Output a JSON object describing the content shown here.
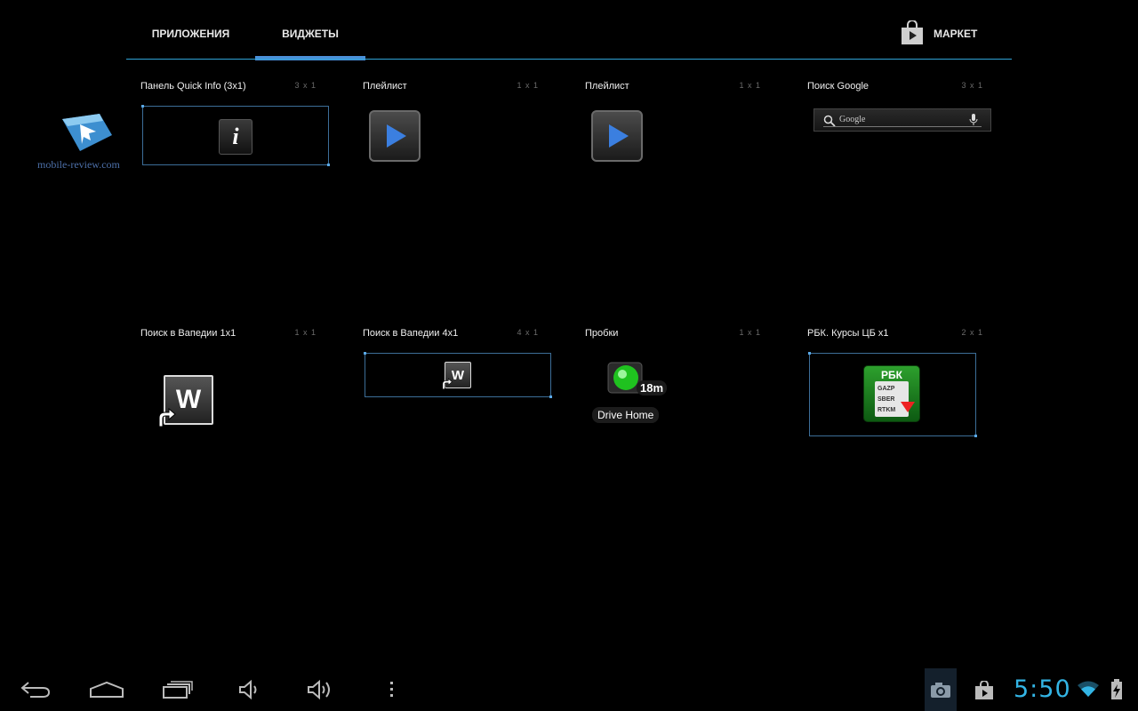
{
  "tabs": [
    {
      "label": "ПРИЛОЖЕНИЯ",
      "selected": false
    },
    {
      "label": "ВИДЖЕТЫ",
      "selected": true
    }
  ],
  "market_label": "МАРКЕТ",
  "watermark": "mobile-review.com",
  "widgets": [
    {
      "name": "Панель Quick Info (3x1)",
      "size": "3 x 1",
      "icon": "info-icon"
    },
    {
      "name": "Плейлист",
      "size": "1 x 1",
      "icon": "play-icon"
    },
    {
      "name": "Плейлист",
      "size": "1 x 1",
      "icon": "play-icon"
    },
    {
      "name": "Поиск Google",
      "size": "3 x 1",
      "icon": "google-search-bar",
      "placeholder": "Google"
    },
    {
      "name": "Поиск в Вапедии 1x1",
      "size": "1 x 1",
      "icon": "wapedia-icon",
      "glyph": "W"
    },
    {
      "name": "Поиск в Вапедии 4x1",
      "size": "4 x 1",
      "icon": "wapedia-icon",
      "glyph": "W"
    },
    {
      "name": "Пробки",
      "size": "1 x 1",
      "icon": "traffic-light-icon",
      "badge": "18m",
      "caption": "Drive Home"
    },
    {
      "name": "РБК. Курсы ЦБ x1",
      "size": "2 x 1",
      "icon": "rbk-icon",
      "logo": "РБК",
      "tickers": [
        "GAZP",
        "SBER",
        "RTKM"
      ]
    }
  ],
  "status_bar": {
    "time": "5:50",
    "icons": [
      "camera-icon",
      "market-bag-icon",
      "wifi-icon",
      "battery-charging-icon"
    ]
  },
  "nav": [
    "back-icon",
    "home-icon",
    "recent-apps-icon",
    "volume-down-icon",
    "volume-up-icon",
    "menu-icon"
  ],
  "colors": {
    "accent": "#33b5e5",
    "tab_indicator": "#4a8fd8",
    "background": "#000000"
  }
}
